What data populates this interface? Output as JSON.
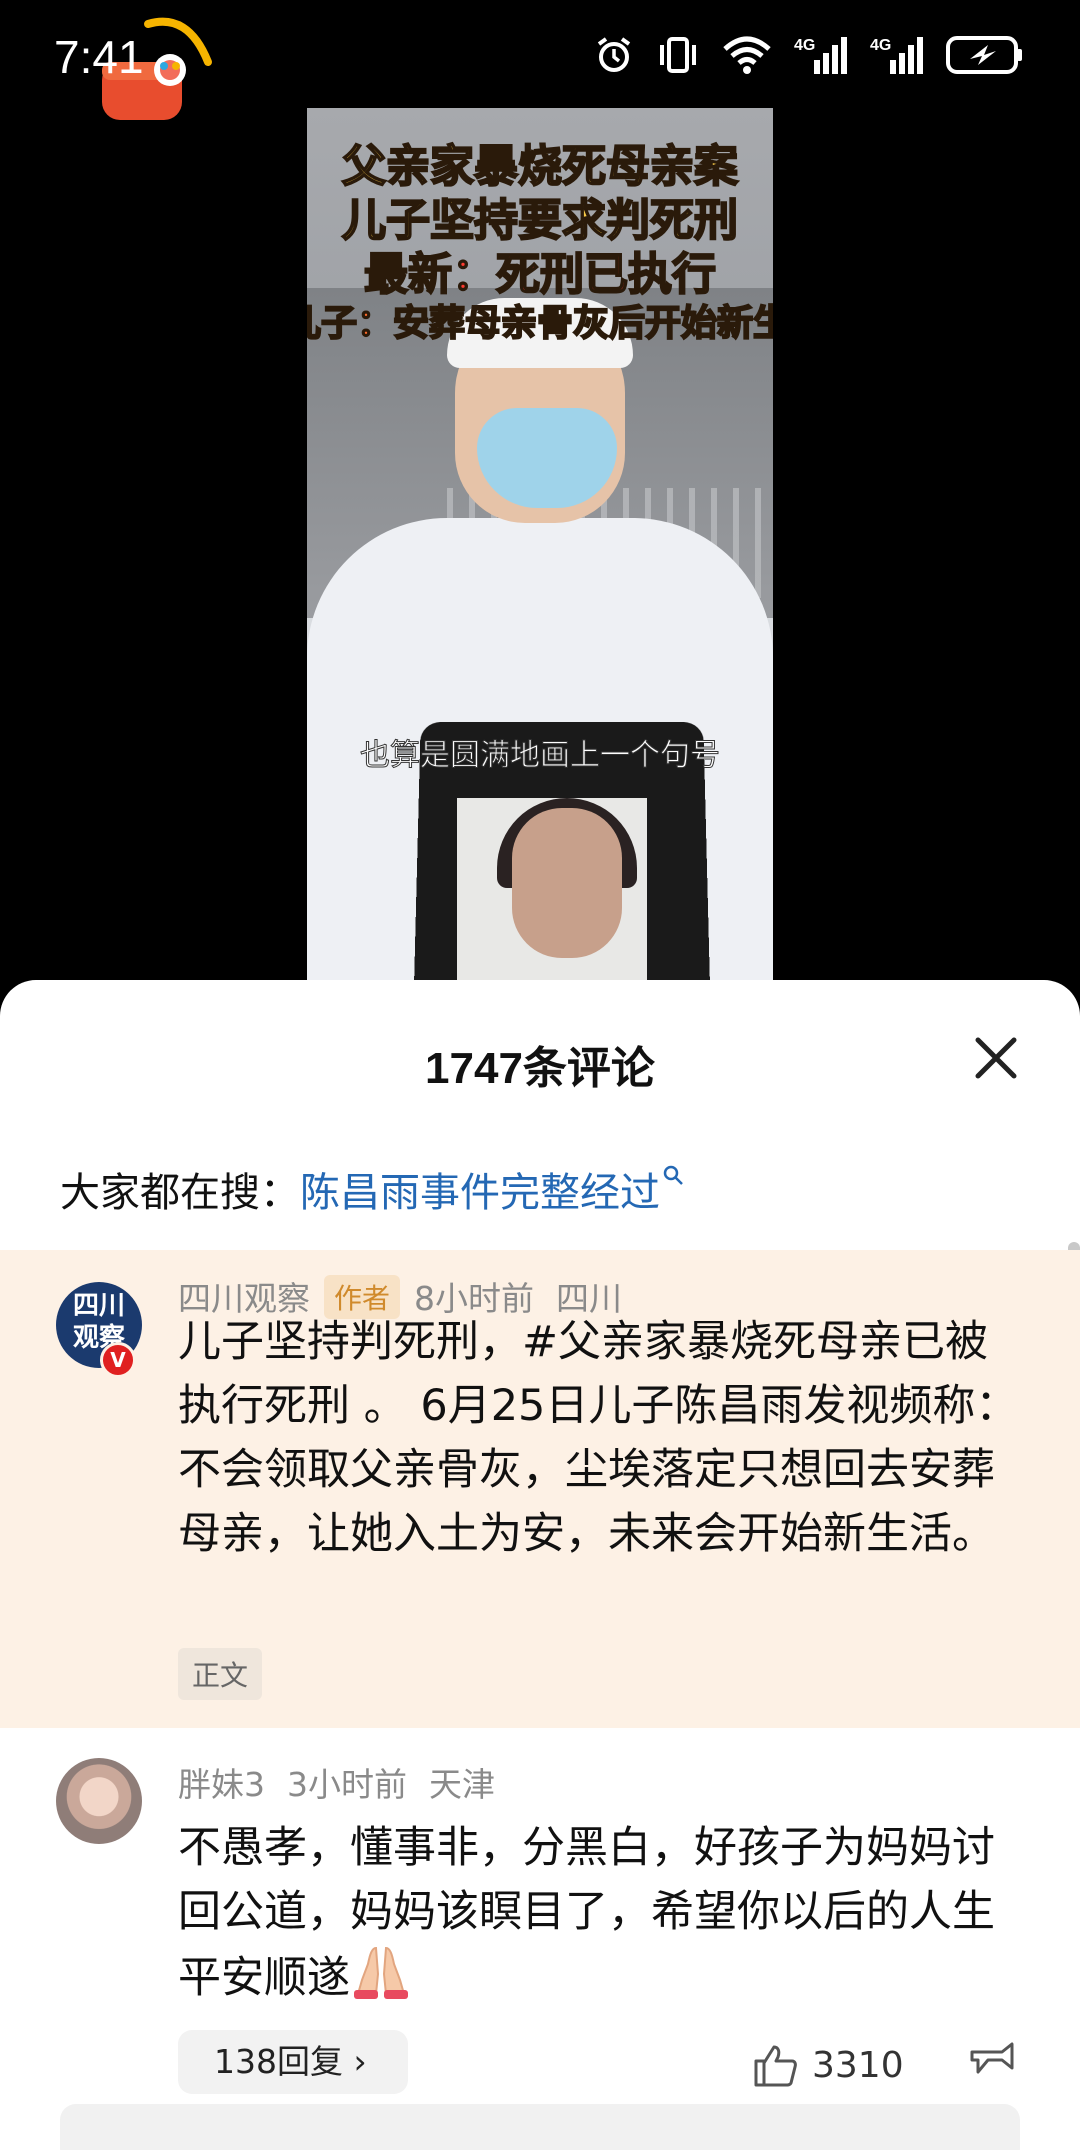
{
  "status_bar": {
    "time": "7:41",
    "icons": [
      "alarm-icon",
      "vibrate-icon",
      "wifi-icon",
      "signal-4g-icon",
      "signal-4g-icon",
      "battery-charging-icon"
    ],
    "network_label_1": "4G",
    "network_label_2": "4G"
  },
  "video": {
    "title_line1": "父亲家暴烧死母亲案",
    "title_line2": "儿子坚持要求判死刑",
    "title_line3": "最新：死刑已执行",
    "title_line4": "儿子：安葬母亲骨灰后开始新生",
    "subtitle": "也算是圆满地画上一个句号"
  },
  "comments_panel": {
    "title": "1747条评论",
    "search_prefix": "大家都在搜：",
    "search_term": "陈昌雨事件完整经过",
    "author_comment": {
      "avatar_text": "四川观察",
      "username": "四川观察",
      "author_tag": "作者",
      "time": "8小时前",
      "location": "四川",
      "text": "儿子坚持判死刑，#父亲家暴烧死母亲已被执行死刑 。 6月25日儿子陈昌雨发视频称：不会领取父亲骨灰，尘埃落定只想回去安葬母亲，让她入土为安，未来会开始新生活。",
      "tag": "正文"
    },
    "user_comment": {
      "username": "胖妹3",
      "time": "3小时前",
      "location": "天津",
      "text": "不愚孝，懂事非，分黑白，好孩子为妈妈讨回公道，妈妈该瞑目了，希望你以后的人生平安顺遂",
      "reply_label": "138回复 ›",
      "like_count": "3310"
    }
  },
  "colors": {
    "link": "#2468b4",
    "author_bg": "#fdf1e5",
    "author_tag_text": "#d08a2c",
    "title_yellow": "#f7c948",
    "title_red": "#ff3b30"
  }
}
